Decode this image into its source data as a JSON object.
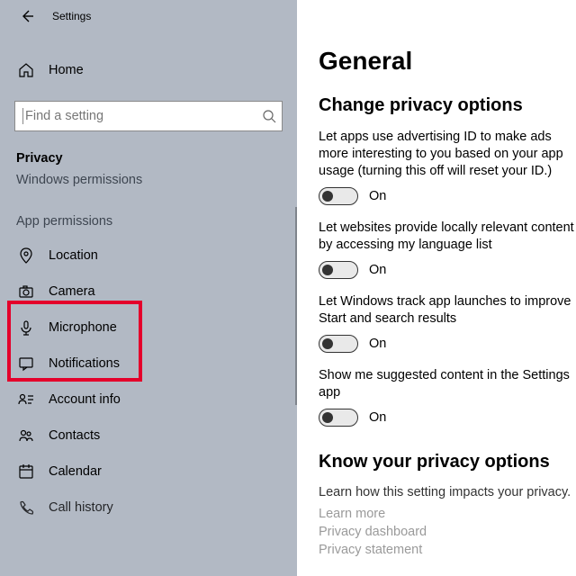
{
  "titlebar": {
    "title": "Settings"
  },
  "search": {
    "placeholder": "Find a setting"
  },
  "home_label": "Home",
  "category": {
    "name": "Privacy",
    "sub": "Windows permissions"
  },
  "section_app_perm": "App permissions",
  "sidebar": {
    "items": [
      {
        "label": "Location"
      },
      {
        "label": "Camera"
      },
      {
        "label": "Microphone"
      },
      {
        "label": "Notifications"
      },
      {
        "label": "Account info"
      },
      {
        "label": "Contacts"
      },
      {
        "label": "Calendar"
      },
      {
        "label": "Call history"
      }
    ]
  },
  "main": {
    "h1": "General",
    "h2": "Change privacy options",
    "opts": [
      {
        "desc": "Let apps use advertising ID to make ads more interesting to you based on your app usage (turning this off will reset your ID.)",
        "state": "On"
      },
      {
        "desc": "Let websites provide locally relevant content by accessing my language list",
        "state": "On"
      },
      {
        "desc": "Let Windows track app launches to improve Start and search results",
        "state": "On"
      },
      {
        "desc": "Show me suggested content in the Settings app",
        "state": "On"
      }
    ],
    "know": {
      "h": "Know your privacy options",
      "p": "Learn how this setting impacts your privacy.",
      "links": [
        "Learn more",
        "Privacy dashboard",
        "Privacy statement"
      ]
    }
  }
}
